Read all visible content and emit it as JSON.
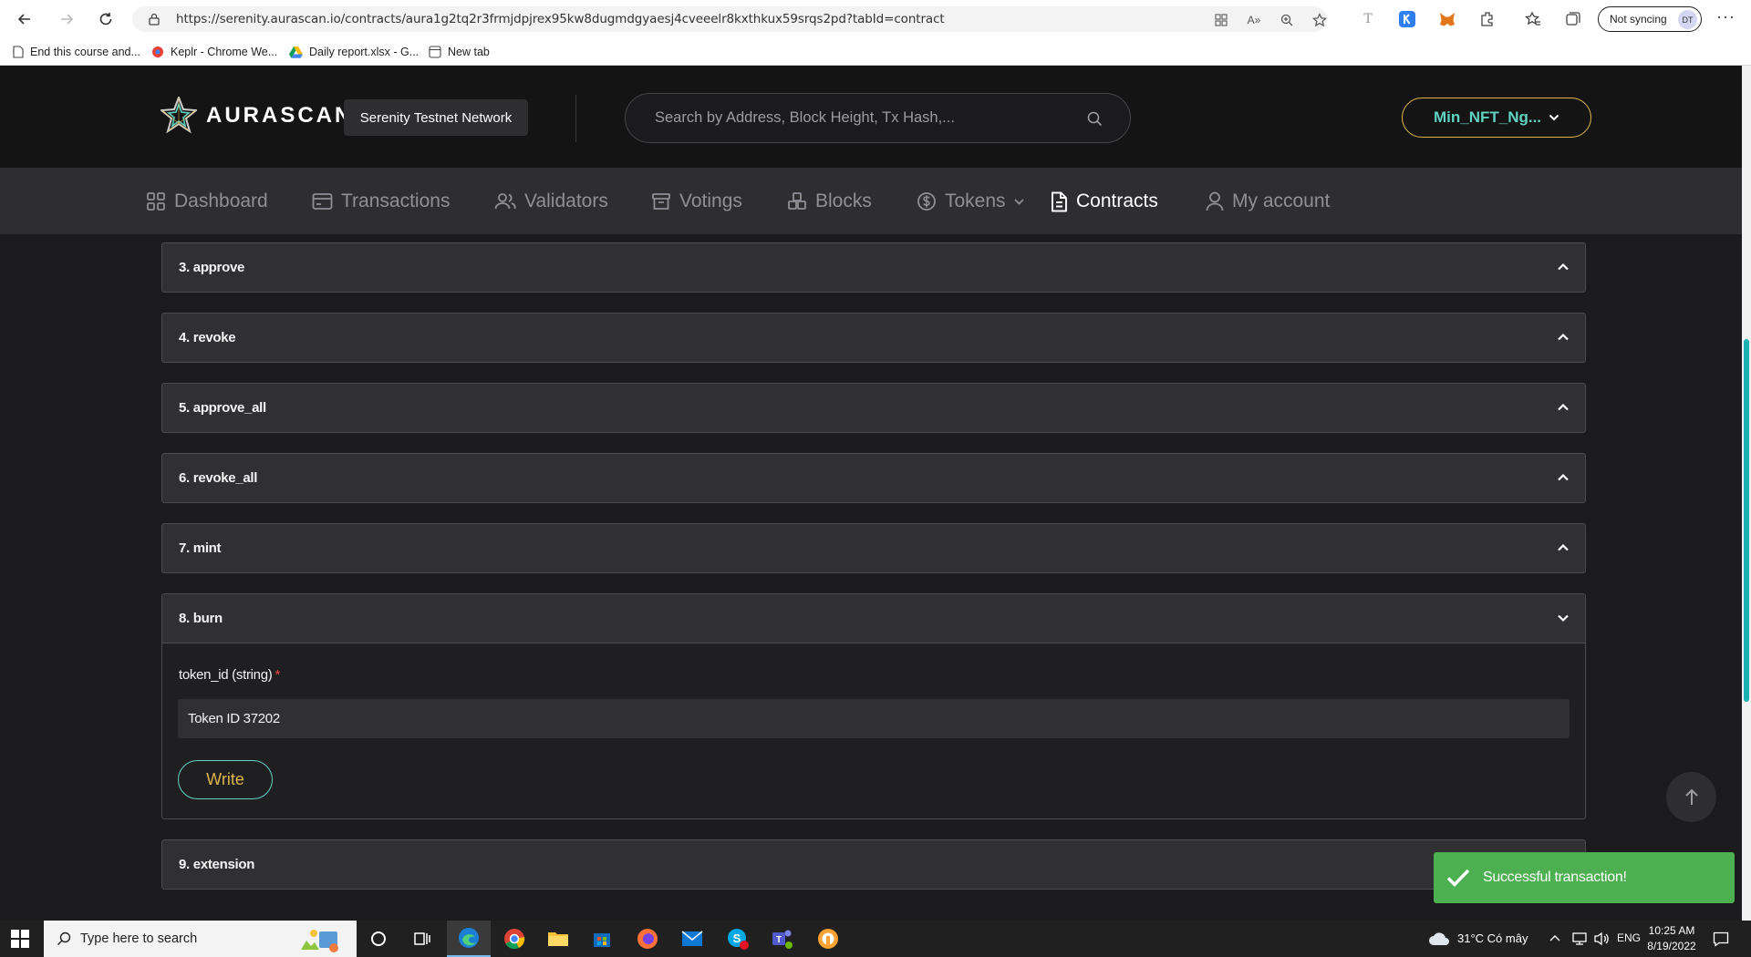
{
  "browser": {
    "url": "https://serenity.aurascan.io/contracts/aura1g2tq2r3frmjdpjrex95kw8dugmdgyaesj4cveeelr8kxthkux59srqs2pd?tabId=contract",
    "sync_label": "Not syncing",
    "avatar_initials": "DT",
    "bookmarks": [
      {
        "label": "End this course and...",
        "icon": "page-icon"
      },
      {
        "label": "Keplr - Chrome We...",
        "icon": "keplr-icon"
      },
      {
        "label": "Daily report.xlsx - G...",
        "icon": "drive-icon"
      },
      {
        "label": "New tab",
        "icon": "newtab-icon"
      }
    ]
  },
  "header": {
    "logo_text": "AURASCAN",
    "network": "Serenity Testnet Network",
    "search_placeholder": "Search by Address, Block Height, Tx Hash,...",
    "account_label": "Min_NFT_Ng..."
  },
  "nav": {
    "items": [
      {
        "label": "Dashboard",
        "icon": "grid-icon",
        "active": false
      },
      {
        "label": "Transactions",
        "icon": "card-icon",
        "active": false
      },
      {
        "label": "Validators",
        "icon": "users-icon",
        "active": false
      },
      {
        "label": "Votings",
        "icon": "archive-icon",
        "active": false
      },
      {
        "label": "Blocks",
        "icon": "blocks-icon",
        "active": false
      },
      {
        "label": "Tokens",
        "icon": "dollar-icon",
        "active": false
      },
      {
        "label": "Contracts",
        "icon": "document-icon",
        "active": true
      },
      {
        "label": "My account",
        "icon": "user-icon",
        "active": false
      }
    ]
  },
  "functions": [
    {
      "title": "3. approve",
      "expanded": false
    },
    {
      "title": "4. revoke",
      "expanded": false
    },
    {
      "title": "5. approve_all",
      "expanded": false
    },
    {
      "title": "6. revoke_all",
      "expanded": false
    },
    {
      "title": "7. mint",
      "expanded": false
    },
    {
      "title": "8. burn",
      "expanded": true
    },
    {
      "title": "9. extension",
      "expanded": false
    }
  ],
  "burn_form": {
    "field_label": "token_id (string)",
    "required_mark": "*",
    "field_value": "Token ID 37202",
    "write_label": "Write"
  },
  "toast": {
    "message": "Successful transaction!"
  },
  "taskbar": {
    "search_placeholder": "Type here to search",
    "weather": "31°C  Có mây",
    "language": "ENG",
    "time": "10:25 AM",
    "date": "8/19/2022"
  },
  "colors": {
    "accent_teal": "#5fd2c2",
    "accent_gold": "#e0b64b",
    "toast_green": "#4caf50",
    "required_red": "#f0493e"
  }
}
